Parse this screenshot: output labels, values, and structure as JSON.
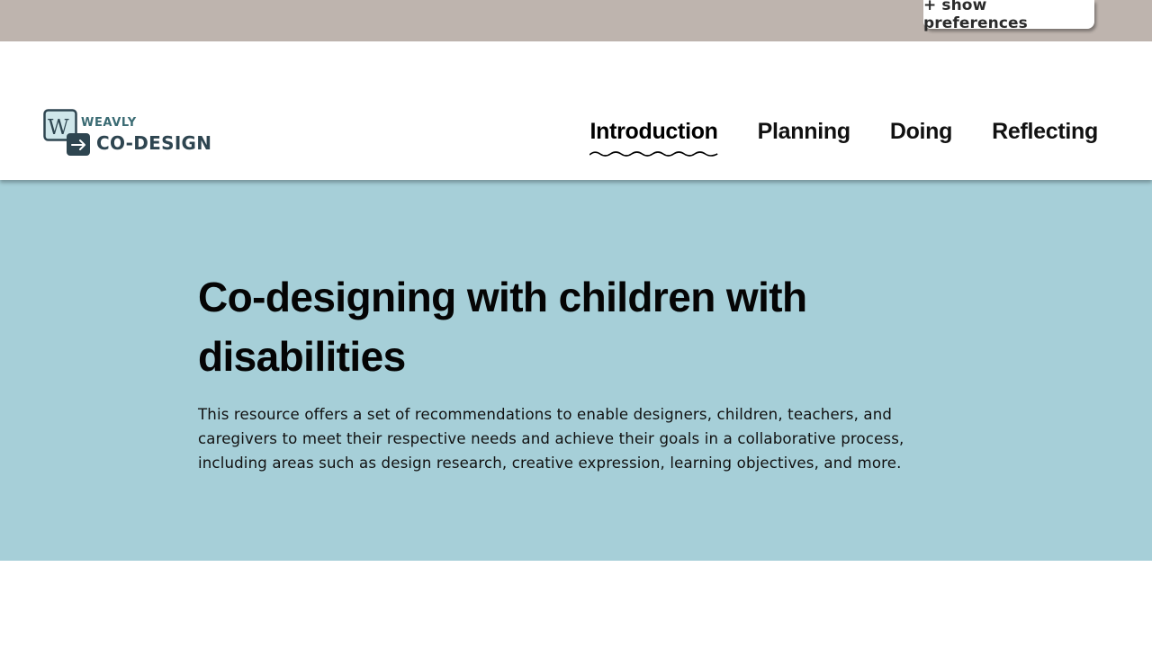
{
  "preferences": {
    "button_label": "+ show preferences"
  },
  "header": {
    "logo": {
      "top_text": "WEAVLY",
      "bottom_text": "CO-DESIGN"
    },
    "nav": {
      "items": [
        {
          "label": "Introduction",
          "active": true
        },
        {
          "label": "Planning",
          "active": false
        },
        {
          "label": "Doing",
          "active": false
        },
        {
          "label": "Reflecting",
          "active": false
        }
      ]
    }
  },
  "hero": {
    "title": "Co-designing with children with disabilities",
    "description": "This resource offers a set of recommendations to enable designers, children, teachers, and caregivers to meet their respective needs and achieve their goals in a collaborative process, including areas such as design research, creative expression, learning objectives, and more."
  },
  "colors": {
    "preferences_bar": "#beb4ae",
    "hero_background": "#a6cfd8",
    "logo_dark": "#2e4550",
    "logo_teal": "#3a6b73"
  }
}
